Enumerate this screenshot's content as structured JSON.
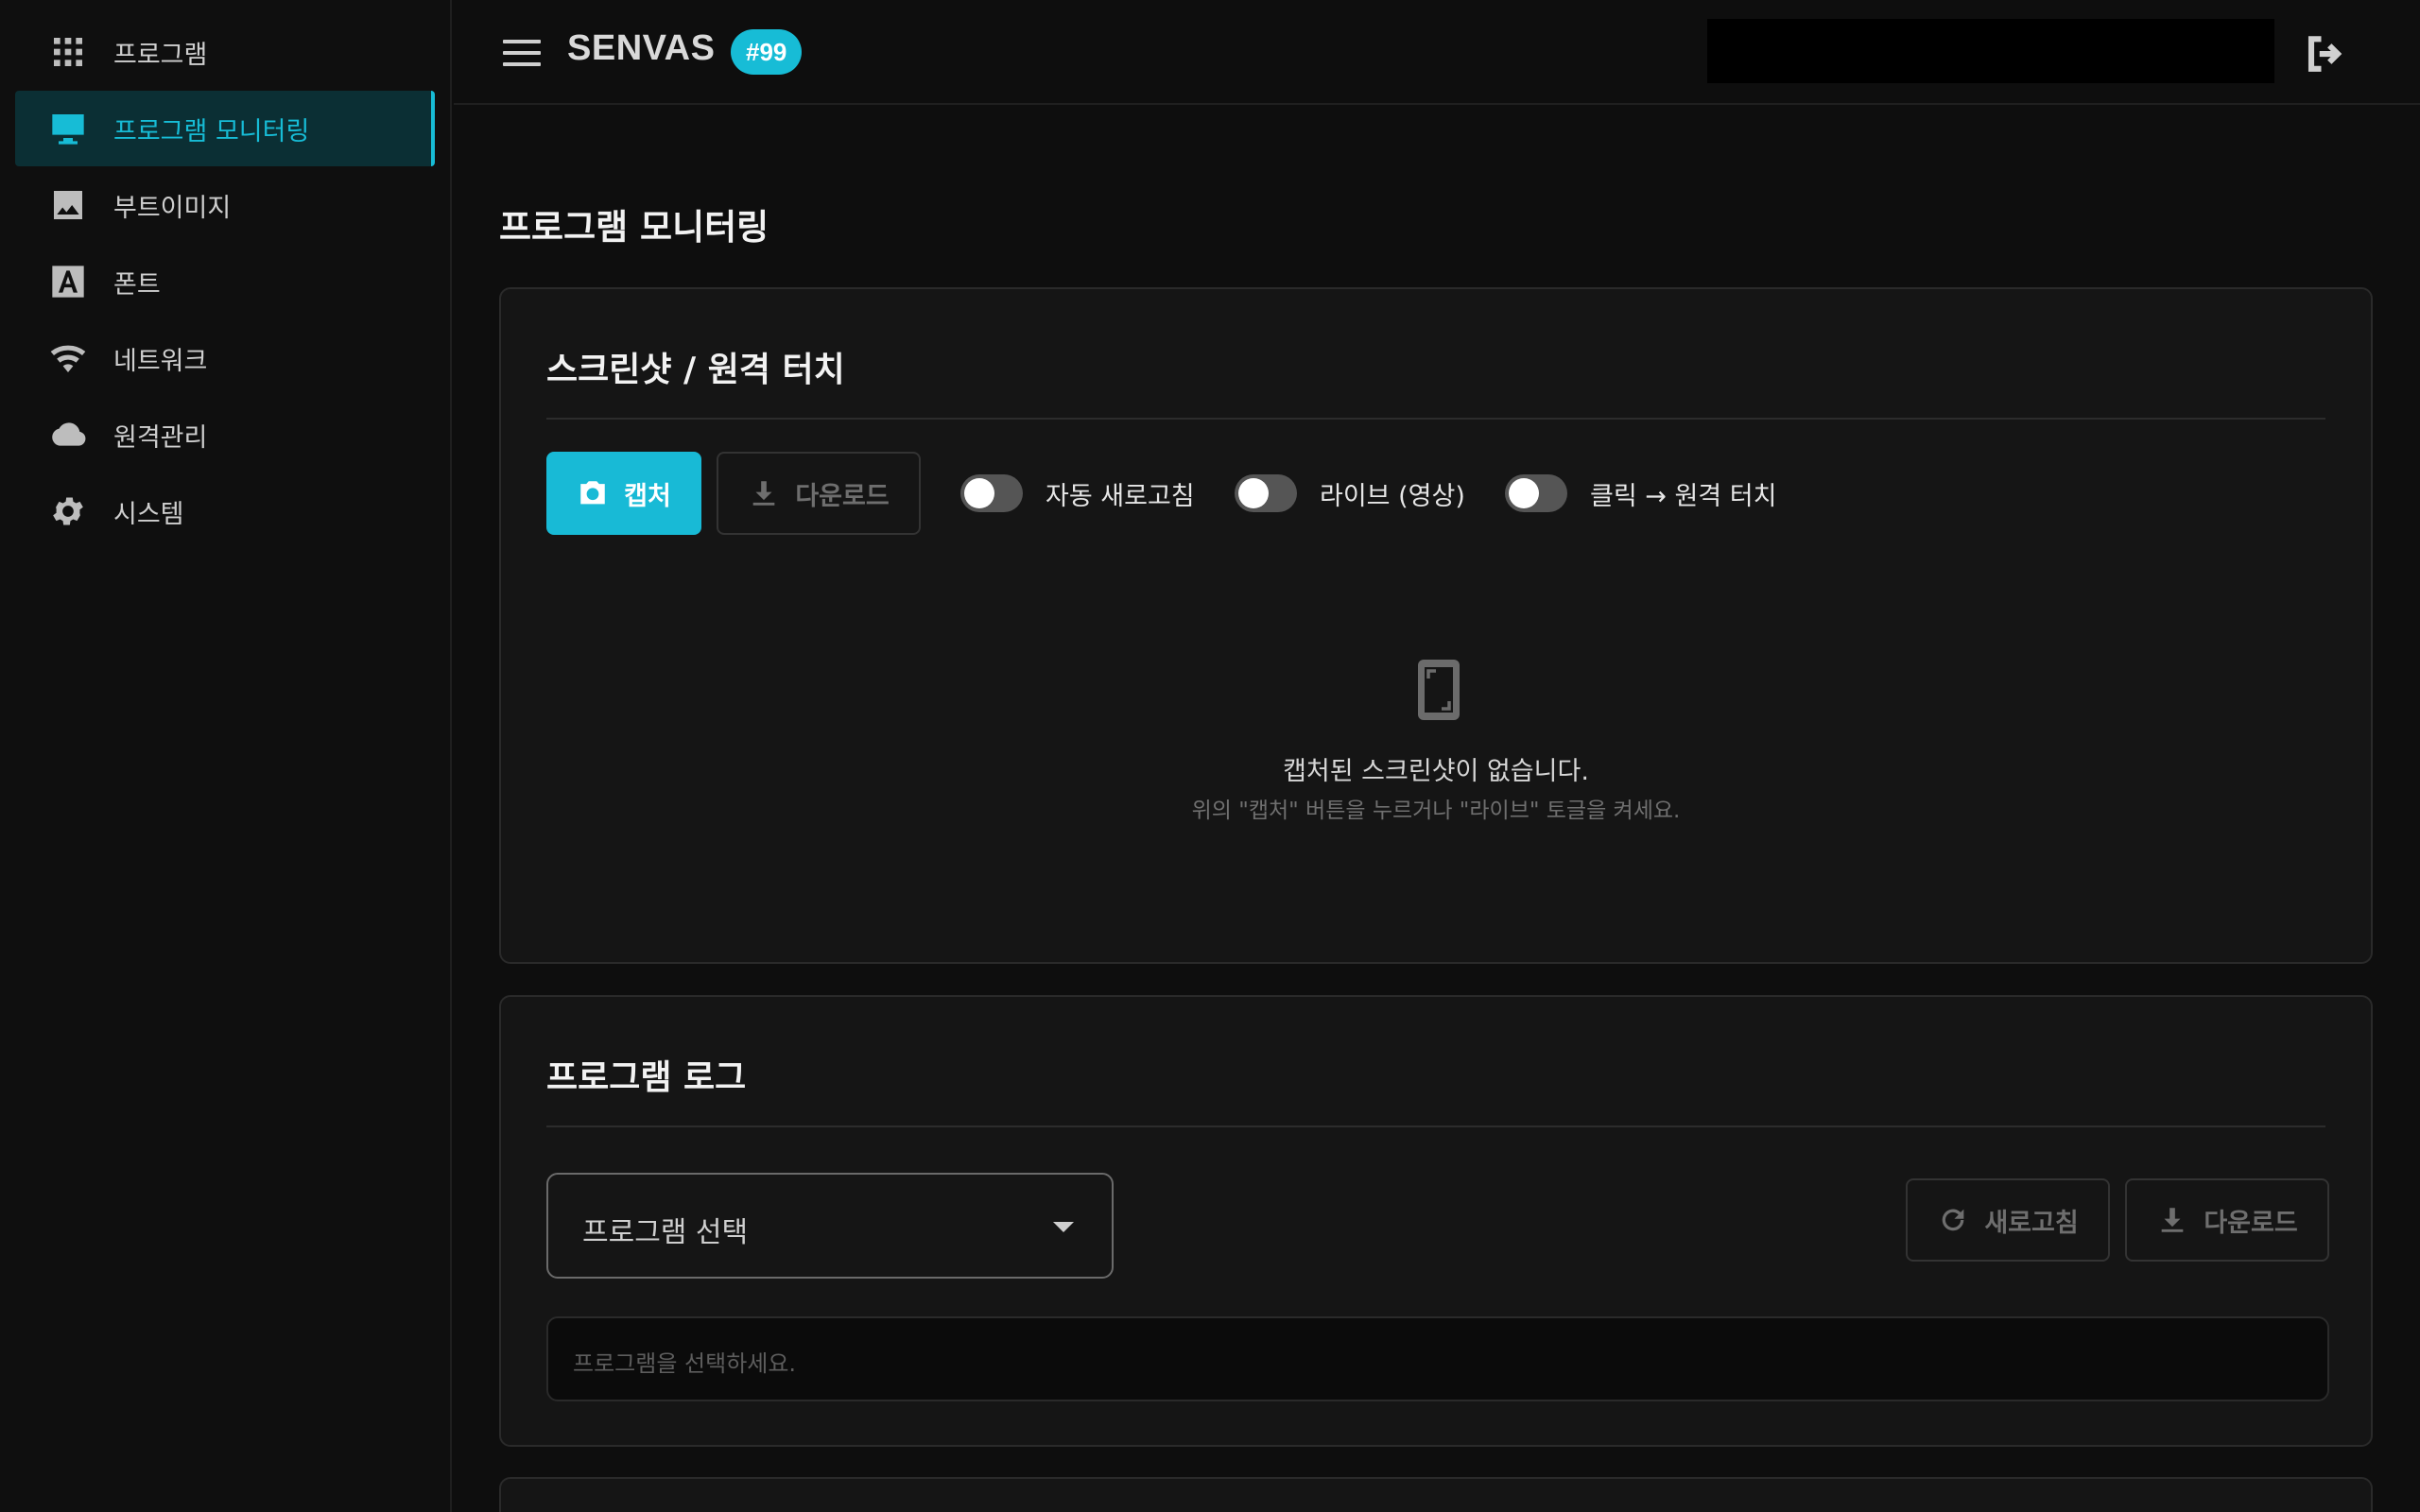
{
  "sidebar": {
    "items": [
      {
        "label": "프로그램",
        "icon": "apps-grid-icon"
      },
      {
        "label": "프로그램 모니터링",
        "icon": "monitor-icon",
        "active": true
      },
      {
        "label": "부트이미지",
        "icon": "image-icon"
      },
      {
        "label": "폰트",
        "icon": "font-icon"
      },
      {
        "label": "네트워크",
        "icon": "wifi-icon"
      },
      {
        "label": "원격관리",
        "icon": "cloud-icon"
      },
      {
        "label": "시스템",
        "icon": "gear-icon"
      }
    ]
  },
  "header": {
    "brand": "SENVAS",
    "badge": "#99"
  },
  "page": {
    "title": "프로그램 모니터링"
  },
  "screenshot": {
    "title": "스크린샷 / 원격 터치",
    "capture_label": "캡처",
    "download_label": "다운로드",
    "toggles": [
      {
        "label": "자동 새로고침",
        "on": false
      },
      {
        "label": "라이브 (영상)",
        "on": false
      },
      {
        "label": "클릭 → 원격 터치",
        "on": false
      }
    ],
    "empty_text": "캡처된 스크린샷이 없습니다.",
    "empty_sub": "위의 \"캡처\" 버튼을 누르거나 \"라이브\" 토글을 켜세요."
  },
  "log": {
    "title": "프로그램 로그",
    "select_label": "프로그램 선택",
    "refresh_label": "새로고침",
    "download_label": "다운로드",
    "placeholder": "프로그램을 선택하세요."
  },
  "colors": {
    "accent": "#18bad6",
    "background": "#0e0e0e",
    "card": "#151515"
  }
}
